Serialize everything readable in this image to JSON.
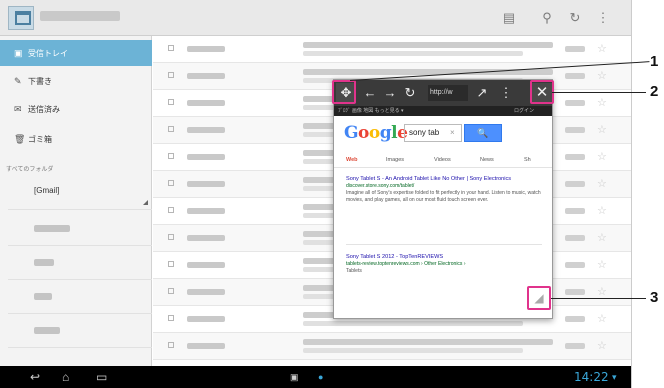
{
  "topbar": {
    "icons": [
      "label-icon",
      "search-icon",
      "refresh-icon",
      "overflow-menu-icon"
    ]
  },
  "sidebar": {
    "items": [
      {
        "label": "受信トレイ",
        "icon": "inbox-icon"
      },
      {
        "label": "下書き",
        "icon": "drafts-icon"
      },
      {
        "label": "送信済み",
        "icon": "sent-icon"
      },
      {
        "label": "ゴミ箱",
        "icon": "trash-icon"
      }
    ],
    "folders_heading": "すべてのフォルダ",
    "selected_folder": "[Gmail]"
  },
  "mail_list": {
    "row_count": 12
  },
  "float_browser": {
    "url": "http://w",
    "nav_strip_left": "ﾌﾞﾛｸﾞ 画像 地図 もっと見る ▾",
    "nav_strip_right": "ログイン",
    "google": {
      "logo": "Google",
      "query": "sony tab",
      "clear": "×",
      "search_button": "🔍",
      "tabs": [
        "Web",
        "Images",
        "Videos",
        "News",
        "Sh"
      ]
    },
    "results": [
      {
        "title": "Sony Tablet S - An Android Tablet Like No Other | Sony Electronics",
        "url": "discover.store.sony.com/tablet/",
        "desc": "Imagine all of Sony's expertise folded to fit perfectly in your hand. Listen to music, watch movies, and play games, all on our most fluid touch screen ever."
      },
      {
        "title": "Sony Tablet S 2012 - TopTenREVIEWS",
        "url": "tablets-review.toptenreviews.com › Other Electronics ›",
        "desc": "Tablets"
      }
    ]
  },
  "navbar": {
    "back": "↩",
    "home": "⌂",
    "recents": "▭",
    "clock": "14:22"
  },
  "callouts": [
    "1",
    "2",
    "3"
  ],
  "colors": {
    "accent_highlight": "#e0338c",
    "sidebar_active": "#6cb3d6",
    "google_blue_button": "#4d90fe",
    "link_blue": "#1a0dab",
    "url_green": "#006621",
    "clock_blue": "#3aa7d8"
  }
}
